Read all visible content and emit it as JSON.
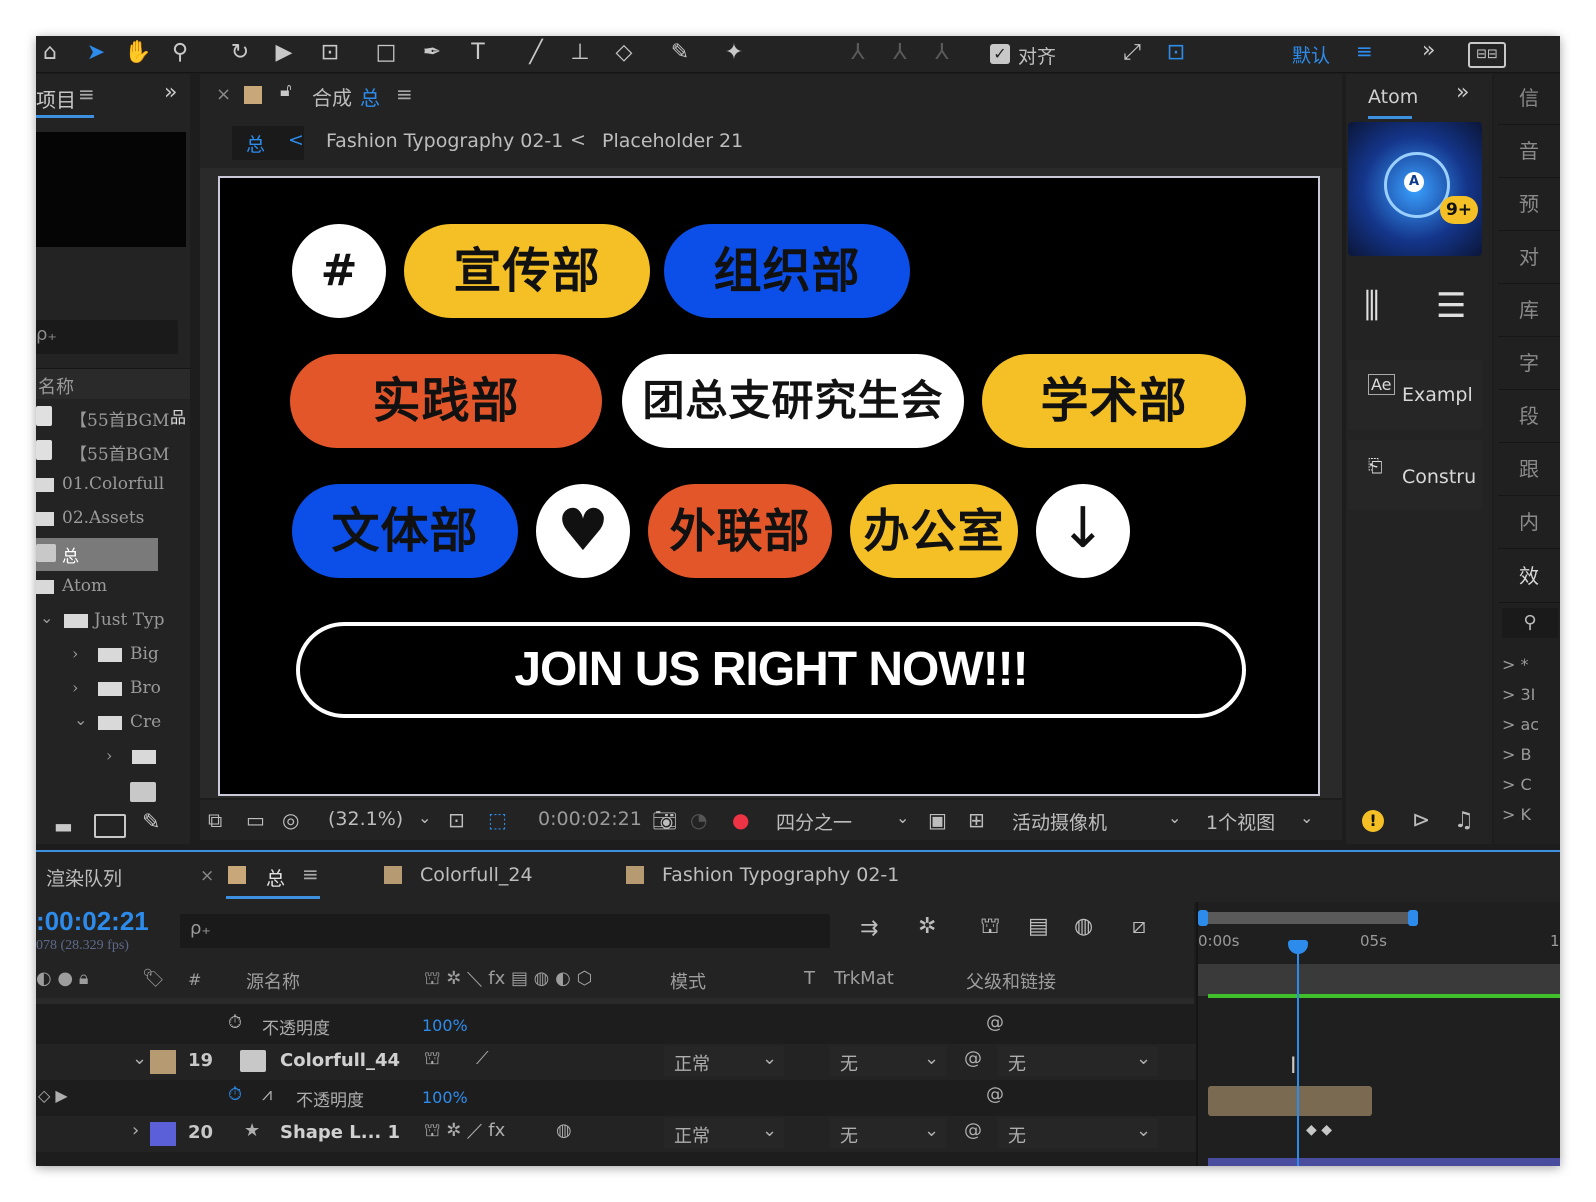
{
  "toolbar": {
    "align_label": "对齐",
    "workspace": "默认",
    "more": "»"
  },
  "project": {
    "tab_label": "项目",
    "menu": "≡",
    "expand": "»",
    "search_placeholder": "ρ₊",
    "name_header": "名称",
    "items": [
      {
        "label": "【55首BGM"
      },
      {
        "label": "【55首BGM"
      },
      {
        "label": "01.Colorfull"
      },
      {
        "label": "02.Assets"
      },
      {
        "label": "总"
      },
      {
        "label": "Atom"
      },
      {
        "label": "Just Typ"
      },
      {
        "label": "Big"
      },
      {
        "label": "Bro"
      },
      {
        "label": "Cre"
      }
    ]
  },
  "comp": {
    "close": "×",
    "title_prefix": "合成",
    "title_name": "总",
    "menu": "≡",
    "breadcrumb": [
      "总",
      "Fashion Typography 02-1",
      "Placeholder 21"
    ],
    "sep": "<"
  },
  "canvas": {
    "hash": "#",
    "pills": [
      "宣传部",
      "组织部",
      "实践部",
      "团总支研究生会",
      "学术部",
      "文体部",
      "外联部",
      "办公室"
    ],
    "heart": "♥",
    "arrow": "↓",
    "cta": "JOIN US RIGHT NOW!!!"
  },
  "viewer": {
    "zoom": "(32.1%)",
    "timecode": "0:00:02:21",
    "resolution": "四分之一",
    "camera": "活动摄像机",
    "views": "1个视图"
  },
  "atom": {
    "tab": "Atom",
    "expand": "»",
    "badge": "9+",
    "items": [
      "Exampl",
      "Constru"
    ]
  },
  "side": {
    "items": [
      "信",
      "音",
      "预",
      "对",
      "库",
      "字",
      "段",
      "跟",
      "内",
      "效"
    ],
    "tree": [
      "> *",
      "> 3I",
      "> ac",
      "> B",
      "> C",
      "> K"
    ]
  },
  "timeline": {
    "render_queue": "渲染队列",
    "tab_active": "总",
    "tab2": "Colorfull_24",
    "tab3": "Fashion Typography 02-1",
    "timecode": ":00:02:21",
    "fps": "078 (28.329 fps)",
    "search_placeholder": "ρ₊",
    "cols": {
      "num": "#",
      "source": "源名称",
      "mode": "模式",
      "t": "T",
      "trkmat": "TrkMat",
      "parent": "父级和链接"
    },
    "ruler": [
      "0:00s",
      "05s",
      "1"
    ],
    "rows": [
      {
        "label": "不透明度",
        "value": "100%"
      },
      {
        "num": "19",
        "name": "Colorfull_44",
        "mode": "正常",
        "trk": "无",
        "parent": "无"
      },
      {
        "label": "不透明度",
        "value": "100%"
      },
      {
        "num": "20",
        "name": "Shape L... 1",
        "mode": "正常",
        "trk": "无",
        "parent": "无"
      }
    ]
  },
  "colors": {
    "accent": "#2d8ceb",
    "yellow": "#f4c025",
    "blue": "#0b4ee8",
    "orange": "#e3562a",
    "label_tan": "#b59a72",
    "label_purple": "#5b5fd8"
  }
}
